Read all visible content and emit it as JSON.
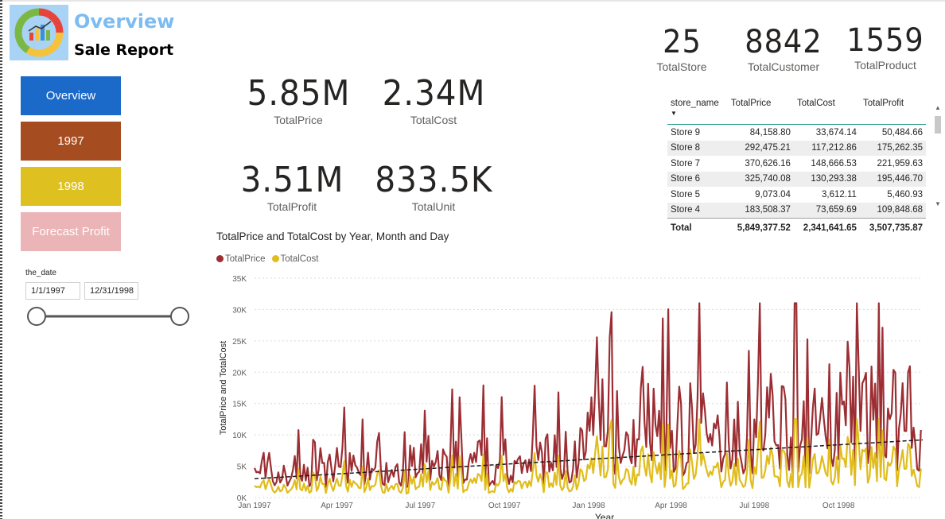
{
  "header": {
    "title": "Overview",
    "subtitle": "Sale Report"
  },
  "nav": [
    {
      "label": "Overview",
      "color": "#1b6ac9"
    },
    {
      "label": "1997",
      "color": "#a64c21"
    },
    {
      "label": "1998",
      "color": "#dfc021"
    },
    {
      "label": "Forecast Profit",
      "color": "#ebb4b7"
    }
  ],
  "kpis": {
    "total_price": {
      "value": "5.85M",
      "label": "TotalPrice"
    },
    "total_cost": {
      "value": "2.34M",
      "label": "TotalCost"
    },
    "total_profit": {
      "value": "3.51M",
      "label": "TotalProfit"
    },
    "total_unit": {
      "value": "833.5K",
      "label": "TotalUnit"
    },
    "total_store": {
      "value": "25",
      "label": "TotalStore"
    },
    "total_customer": {
      "value": "8842",
      "label": "TotalCustomer"
    },
    "total_product": {
      "value": "1559",
      "label": "TotalProduct"
    }
  },
  "slicer": {
    "title": "the_date",
    "start": "1/1/1997",
    "end": "12/31/1998"
  },
  "store_table": {
    "columns": [
      "store_name",
      "TotalPrice",
      "TotalCost",
      "TotalProfit"
    ],
    "rows": [
      [
        "Store 9",
        "84,158.80",
        "33,674.14",
        "50,484.66"
      ],
      [
        "Store 8",
        "292,475.21",
        "117,212.86",
        "175,262.35"
      ],
      [
        "Store 7",
        "370,626.16",
        "148,666.53",
        "221,959.63"
      ],
      [
        "Store 6",
        "325,740.08",
        "130,293.38",
        "195,446.70"
      ],
      [
        "Store 5",
        "9,073.04",
        "3,612.11",
        "5,460.93"
      ],
      [
        "Store 4",
        "183,508.37",
        "73,659.69",
        "109,848.68"
      ]
    ],
    "total": [
      "Total",
      "5,849,377.52",
      "2,341,641.65",
      "3,507,735.87"
    ]
  },
  "chart_data": {
    "type": "line",
    "title": "TotalPrice and TotalCost by Year, Month and Day",
    "xlabel": "Year",
    "ylabel": "TotalPrice and TotalCost",
    "ylim": [
      0,
      35000
    ],
    "yticks": [
      "0K",
      "5K",
      "10K",
      "15K",
      "20K",
      "25K",
      "30K",
      "35K"
    ],
    "xticks": [
      "Jan 1997",
      "Apr 1997",
      "Jul 1997",
      "Oct 1997",
      "Jan 1998",
      "Apr 1998",
      "Jul 1998",
      "Oct 1998"
    ],
    "grid": true,
    "legend": "top-left",
    "series": [
      {
        "name": "TotalPrice",
        "color": "#9c2e33",
        "x": [
          "1997-01",
          "1997-02",
          "1997-03",
          "1997-04",
          "1997-05",
          "1997-06",
          "1997-07",
          "1997-08",
          "1997-09",
          "1997-10",
          "1997-11",
          "1997-12",
          "1998-01",
          "1998-02",
          "1998-03",
          "1998-04",
          "1998-05",
          "1998-06",
          "1998-07",
          "1998-08",
          "1998-09",
          "1998-10",
          "1998-11",
          "1998-12"
        ],
        "values": [
          4000,
          3800,
          4800,
          4200,
          4600,
          4500,
          5000,
          5200,
          4800,
          5300,
          5400,
          6000,
          9500,
          9000,
          9800,
          10000,
          9800,
          10200,
          10500,
          10000,
          10800,
          11000,
          11500,
          11000
        ]
      },
      {
        "name": "TotalCost",
        "color": "#e0bd1c",
        "x": [
          "1997-01",
          "1997-02",
          "1997-03",
          "1997-04",
          "1997-05",
          "1997-06",
          "1997-07",
          "1997-08",
          "1997-09",
          "1997-10",
          "1997-11",
          "1997-12",
          "1998-01",
          "1998-02",
          "1998-03",
          "1998-04",
          "1998-05",
          "1998-06",
          "1998-07",
          "1998-08",
          "1998-09",
          "1998-10",
          "1998-11",
          "1998-12"
        ],
        "values": [
          1600,
          1500,
          1900,
          1700,
          1850,
          1800,
          2000,
          2100,
          1900,
          2100,
          2150,
          2400,
          3800,
          3600,
          3900,
          4000,
          3900,
          4100,
          4200,
          4000,
          4300,
          4400,
          4600,
          4400
        ]
      }
    ],
    "trendline": {
      "color": "#1a1a1a",
      "start": 3000,
      "end": 9200
    }
  }
}
